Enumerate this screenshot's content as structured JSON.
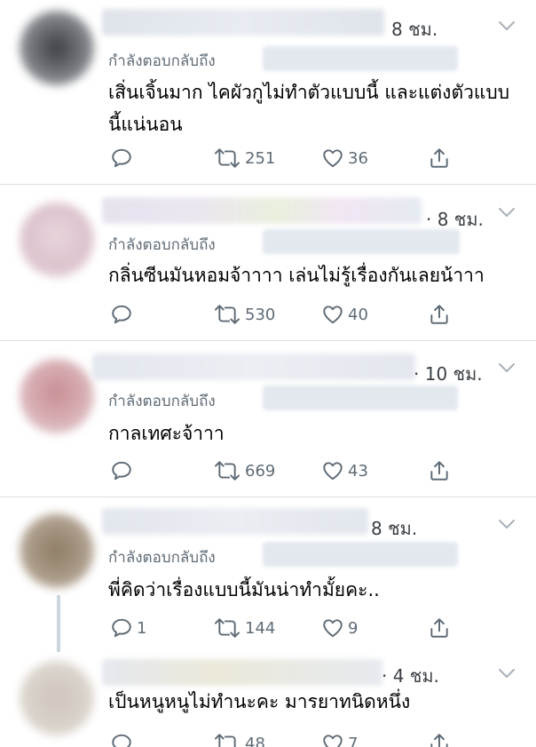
{
  "reply_prefix": "กำลังตอบกลับถึง",
  "tweets": [
    {
      "time": "8 ชม.",
      "text": "เสิ่นเจิ้นมาก ไคผัวกูไม่ทำตัวแบบนี้ และแต่งตัวแบบนี้แน่นอน",
      "reply_count": "",
      "retweet_count": "251",
      "like_count": "36"
    },
    {
      "time": "· 8 ชม.",
      "text": "กลิ่นซีนมันหอมจ้าาาา เล่นไม่รู้เรื่องกันเลยน้าาา",
      "reply_count": "",
      "retweet_count": "530",
      "like_count": "40"
    },
    {
      "time": "· 10 ชม.",
      "text": "กาลเทศะจ้าาา",
      "reply_count": "",
      "retweet_count": "669",
      "like_count": "43"
    },
    {
      "time": "8 ชม.",
      "text": "พี่คิดว่าเรื่องแบบนี้มันน่าทำมั้ยคะ..",
      "reply_count": "1",
      "retweet_count": "144",
      "like_count": "9"
    },
    {
      "time": "· 4 ชม.",
      "text": "เป็นหนูหนูไม่ทำนะคะ มารยาทนิดหนึ่ง",
      "reply_count": "",
      "retweet_count": "48",
      "like_count": "7"
    }
  ],
  "colors": {
    "icon": "#5f6b76",
    "divider": "#d9dee2",
    "thread_line": "#ccd6dd"
  },
  "icons": [
    "reply-icon",
    "retweet-icon",
    "like-icon",
    "share-icon",
    "chevron-down-icon"
  ]
}
